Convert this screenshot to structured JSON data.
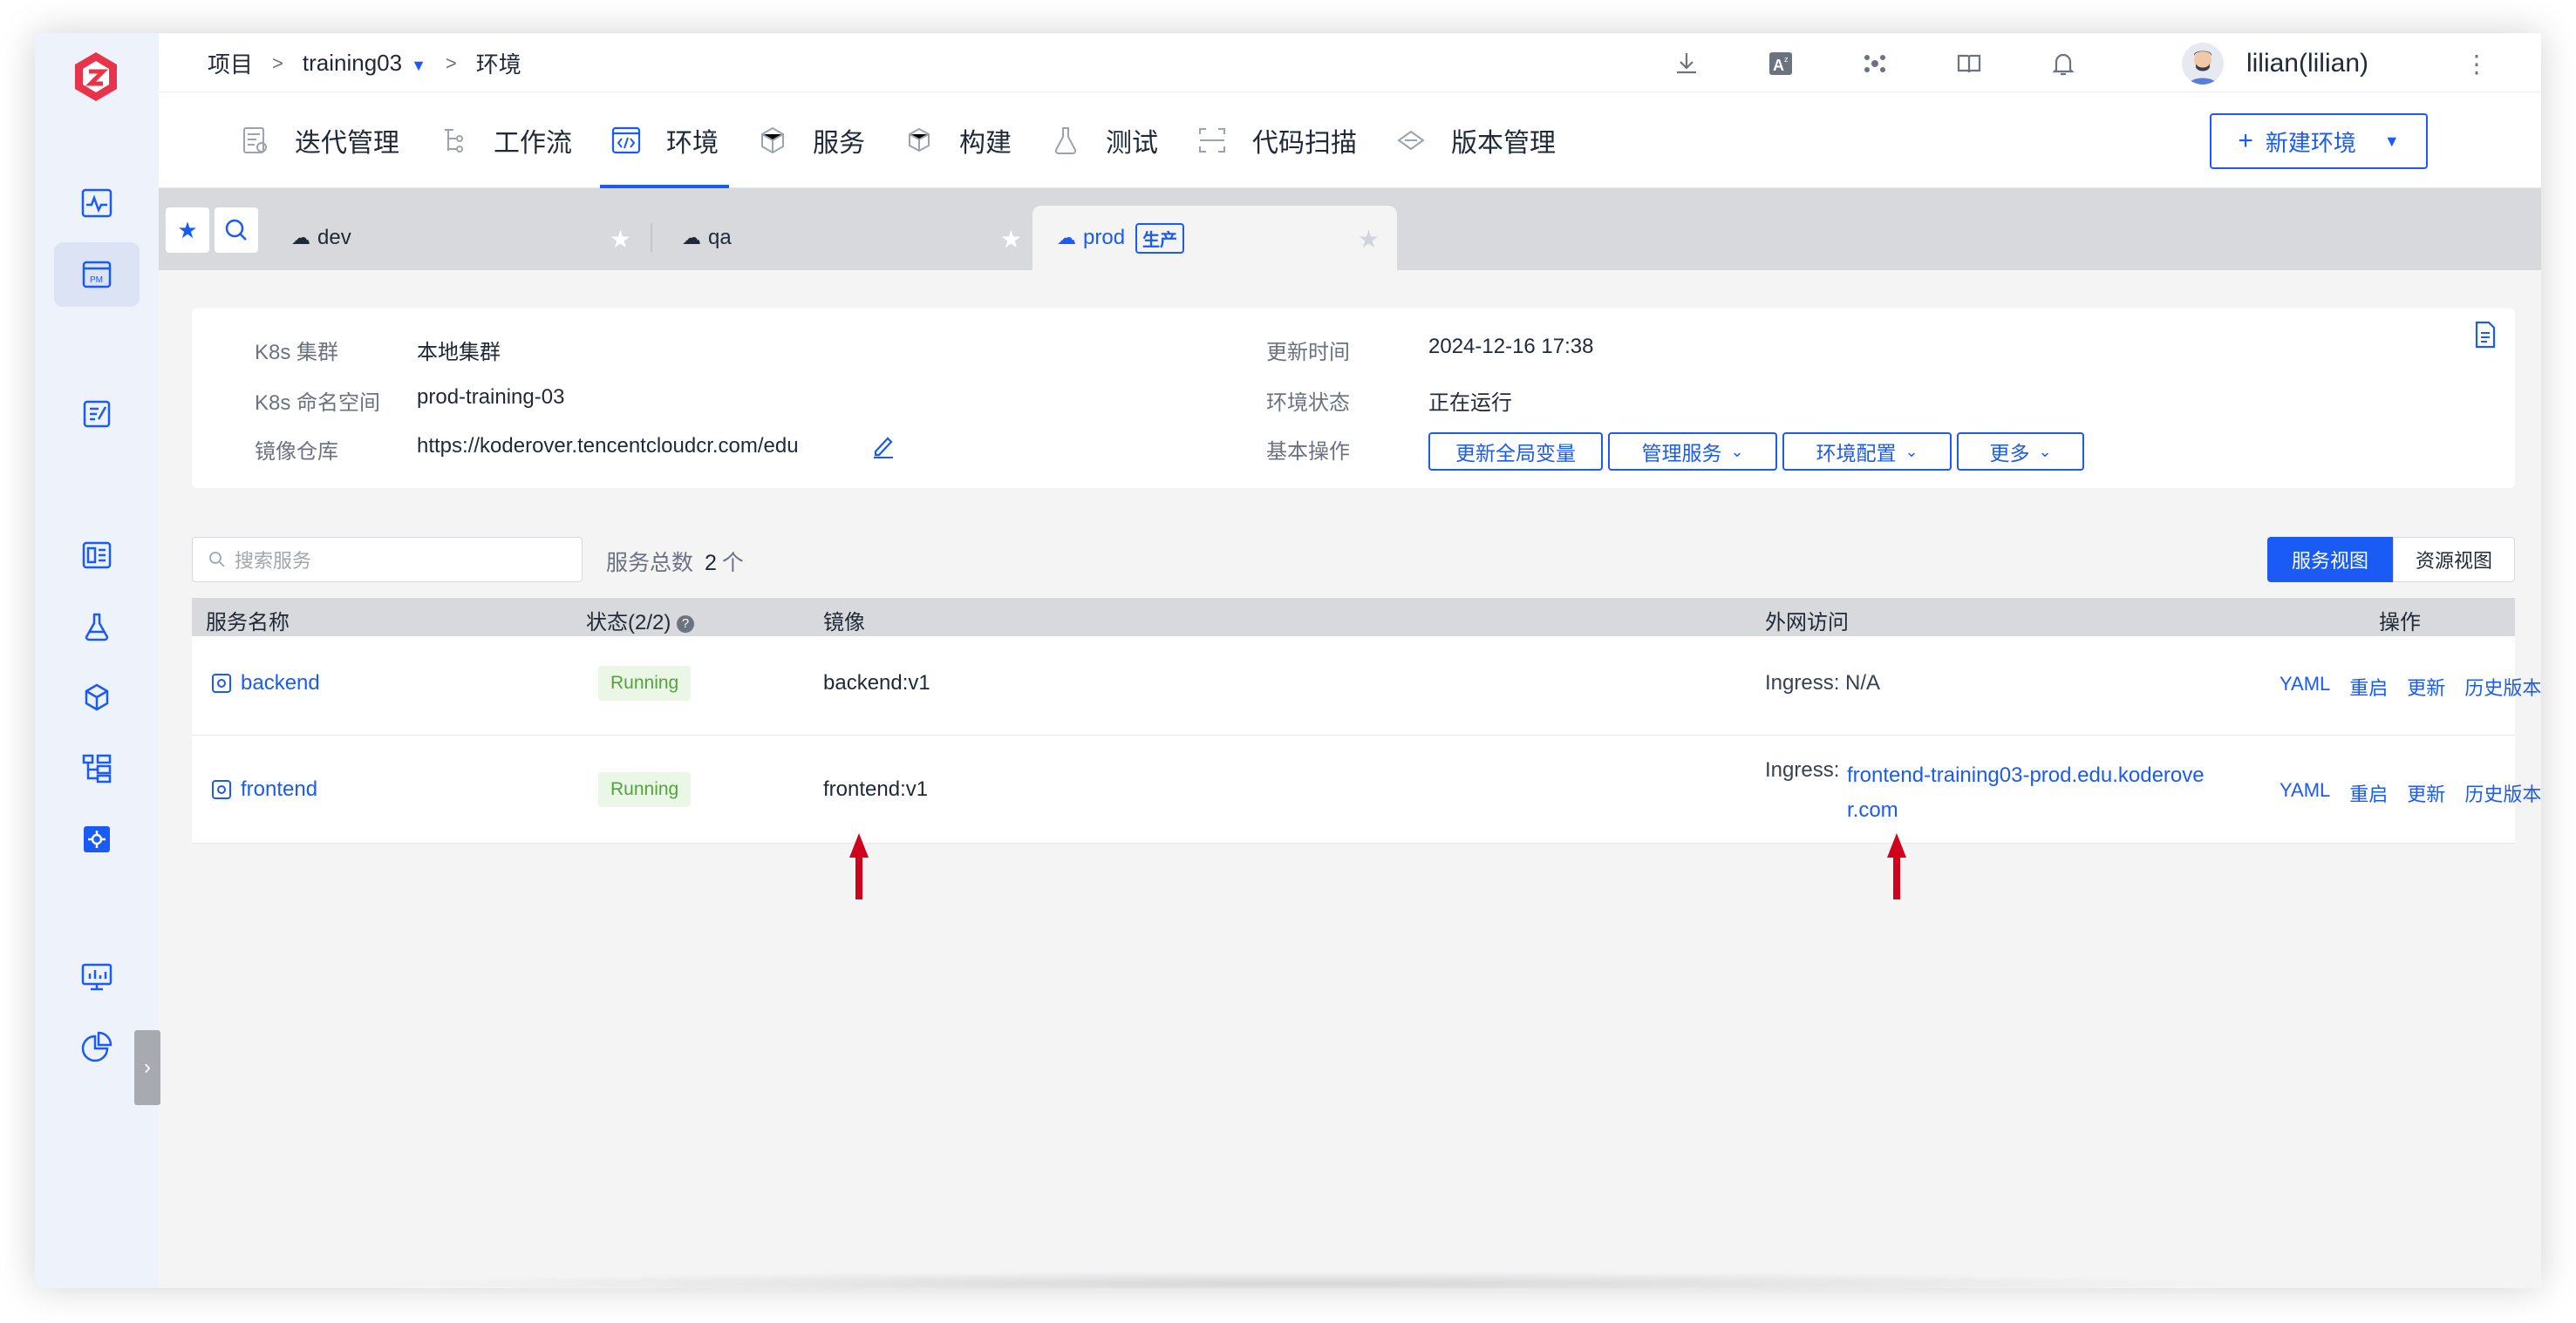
{
  "breadcrumb": {
    "item1": "项目",
    "sep": ">",
    "project": "training03",
    "env": "环境"
  },
  "user": {
    "name": "lilian(lilian)"
  },
  "nav": [
    {
      "label": "迭代管理",
      "icon": "iteration-icon"
    },
    {
      "label": "工作流",
      "icon": "workflow-icon"
    },
    {
      "label": "环境",
      "icon": "environment-icon"
    },
    {
      "label": "服务",
      "icon": "service-icon"
    },
    {
      "label": "构建",
      "icon": "build-icon"
    },
    {
      "label": "测试",
      "icon": "test-icon"
    },
    {
      "label": "代码扫描",
      "icon": "code-scan-icon"
    },
    {
      "label": "版本管理",
      "icon": "version-icon"
    }
  ],
  "new_env_label": "新建环境",
  "env_tabs": [
    {
      "name": "dev"
    },
    {
      "name": "qa"
    },
    {
      "name": "prod",
      "badge": "生产"
    }
  ],
  "info": {
    "cluster_label": "K8s 集群",
    "cluster_value": "本地集群",
    "ns_label": "K8s 命名空间",
    "ns_value": "prod-training-03",
    "registry_label": "镜像仓库",
    "registry_value": "https://koderover.tencentcloudcr.com/edu",
    "updated_label": "更新时间",
    "updated_value": "2024-12-16 17:38",
    "status_label": "环境状态",
    "status_value": "正在运行",
    "ops_label": "基本操作",
    "ops": [
      "更新全局变量",
      "管理服务",
      "环境配置",
      "更多"
    ]
  },
  "search": {
    "placeholder": "搜索服务"
  },
  "svc_count": {
    "label": "服务总数",
    "value": "2",
    "unit": "个"
  },
  "view_toggle": {
    "service_view": "服务视图",
    "resource_view": "资源视图"
  },
  "table": {
    "headers": {
      "name": "服务名称",
      "status": "状态(2/2)",
      "image": "镜像",
      "access": "外网访问",
      "ops": "操作"
    },
    "rows": [
      {
        "name": "backend",
        "status": "Running",
        "image": "backend:v1",
        "ingress_label": "Ingress:",
        "ingress_value": "N/A"
      },
      {
        "name": "frontend",
        "status": "Running",
        "image": "frontend:v1",
        "ingress_label": "Ingress:",
        "ingress_line1": "frontend-training03-prod.edu.koderove",
        "ingress_line2": "r.com"
      }
    ],
    "actions": [
      "YAML",
      "重启",
      "更新",
      "历史版本"
    ]
  },
  "colors": {
    "accent": "#1a5bf5",
    "running_bg": "#eaf7e6",
    "running_text": "#52a43a",
    "annotation_arrow": "#d0021b"
  }
}
